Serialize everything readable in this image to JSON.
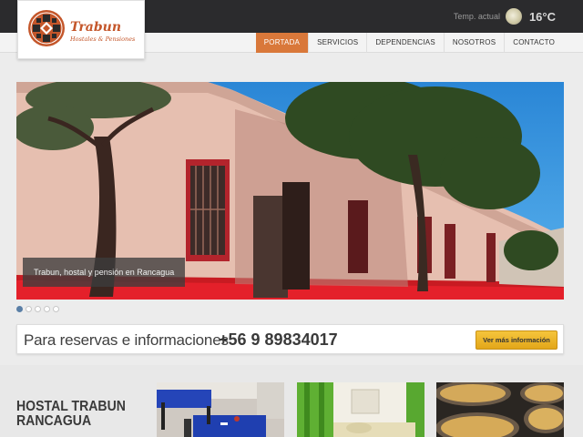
{
  "header": {
    "logo": {
      "brand": "Trabun",
      "tagline": "Hostales & Pensiones"
    },
    "weather": {
      "label": "Temp. actual",
      "temperature": "16°C",
      "icon": "sun-icon"
    },
    "nav": [
      {
        "label": "PORTADA",
        "active": true
      },
      {
        "label": "SERVICIOS"
      },
      {
        "label": "DEPENDENCIAS"
      },
      {
        "label": "NOSOTROS"
      },
      {
        "label": "CONTACTO"
      }
    ]
  },
  "slider": {
    "caption": "Trabun, hostal y pensión en Rancagua",
    "slide_count": 5,
    "active_slide": 1
  },
  "reservation": {
    "text": "Para reservas e informaciones",
    "phone": "+56 9 89834017",
    "button": "Ver más información"
  },
  "featured": {
    "title_line1": "HOSTAL TRABUN",
    "title_line2": "RANCAGUA"
  },
  "colors": {
    "accent": "#d9783a",
    "brand": "#c4562a",
    "button": "#e9b22a",
    "topbar": "#2b2b2d"
  }
}
